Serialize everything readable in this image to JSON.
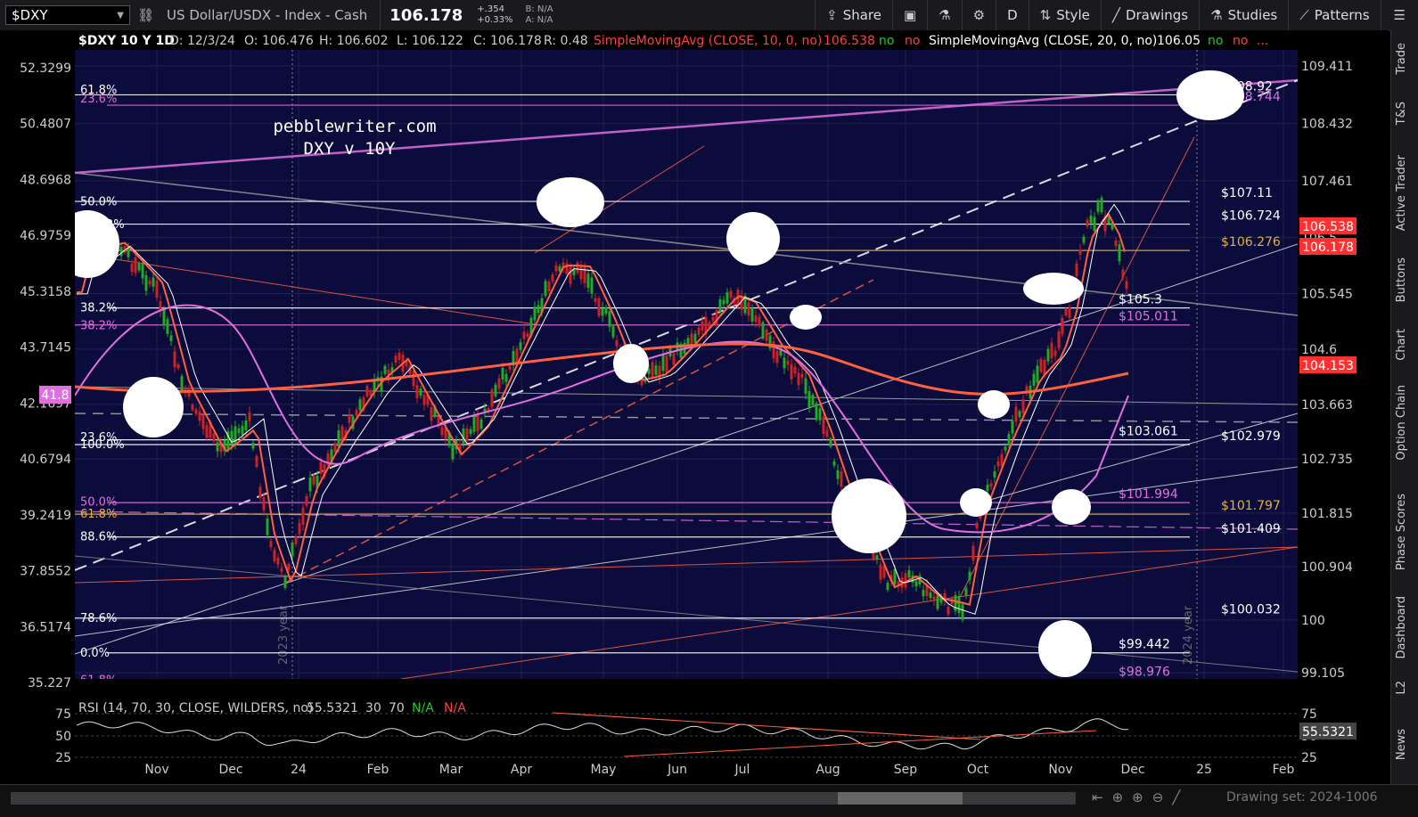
{
  "toolbar": {
    "symbol": "$DXY",
    "description": "US Dollar/USDX - Index - Cash",
    "last": "106.178",
    "change": "+.354",
    "change_pct": "+0.33%",
    "bid": "B: N/A",
    "ask": "A: N/A",
    "share": "Share",
    "period": "D",
    "style": "Style",
    "drawings": "Drawings",
    "studies": "Studies",
    "patterns": "Patterns"
  },
  "header": {
    "title": "$DXY 10 Y 1D",
    "date": "D: 12/3/24",
    "open": "O: 106.476",
    "high": "H: 106.602",
    "low": "L: 106.122",
    "close": "C: 106.178",
    "range": "R: 0.48",
    "sma10_label": "SimpleMovingAvg (CLOSE, 10, 0, no)",
    "sma10_value": "106.538",
    "sma20_label": "SimpleMovingAvg (CLOSE, 20, 0, no)",
    "sma20_value": "106.05",
    "no": "no",
    "more": "..."
  },
  "side_tabs": [
    "Trade",
    "T&S",
    "Active Trader",
    "Buttons",
    "Chart",
    "Option Chain",
    "Phase Scores",
    "Dashboard",
    "L2",
    "News"
  ],
  "watermark": {
    "line1": "pebblewriter.com",
    "line2": "DXY v 10Y"
  },
  "colors": {
    "background": "#0b0b3c",
    "candle_up": "#22aa22",
    "candle_down": "#cc2222",
    "sma10": "#ff6040",
    "sma20": "#ffffff",
    "magenta": "#e070e0",
    "gold": "#e0b040"
  },
  "chart_data": {
    "type": "candlestick",
    "x_months": [
      "Nov",
      "Dec",
      "24",
      "Feb",
      "Mar",
      "Apr",
      "May",
      "Jun",
      "Jul",
      "Aug",
      "Sep",
      "Oct",
      "Nov",
      "Dec",
      "25",
      "Feb"
    ],
    "year_markers": [
      "2023 year",
      "2024 year"
    ],
    "right_axis_dxy": {
      "ylim": [
        99.105,
        109.411
      ],
      "ticks": [
        "109.411",
        "108.432",
        "107.461",
        "106.5",
        "105.545",
        "104.6",
        "103.663",
        "102.735",
        "101.815",
        "100.904",
        "100",
        "99.105"
      ]
    },
    "left_axis_10y": {
      "ylim": [
        35.227,
        52.3299
      ],
      "ticks": [
        "52.3299",
        "50.4807",
        "48.6968",
        "46.9759",
        "45.3158",
        "43.7145",
        "42.1697",
        "40.6794",
        "39.2419",
        "37.8552",
        "36.5174",
        "35.227"
      ],
      "current": "41.8"
    },
    "last_price_labels": [
      {
        "value": "106.538",
        "color": "#ff3030"
      },
      {
        "value": "106.178",
        "color": "#ff3030"
      },
      {
        "value": "104.153",
        "color": "#ff3030"
      }
    ],
    "levels": [
      {
        "label": "$108.92",
        "price": 108.92,
        "color": "#ffffff"
      },
      {
        "label": "$108.744",
        "price": 108.744,
        "color": "#e070e0"
      },
      {
        "label": "$107.11",
        "price": 107.11,
        "color": "#ffffff"
      },
      {
        "label": "$106.724",
        "price": 106.724,
        "color": "#ffffff"
      },
      {
        "label": "$106.276",
        "price": 106.276,
        "color": "#e0b040"
      },
      {
        "label": "$105.3",
        "price": 105.3,
        "color": "#ffffff"
      },
      {
        "label": "$105.011",
        "price": 105.011,
        "color": "#e070e0"
      },
      {
        "label": "$103.061",
        "price": 103.061,
        "color": "#ffffff"
      },
      {
        "label": "$102.979",
        "price": 102.979,
        "color": "#ffffff"
      },
      {
        "label": "$101.994",
        "price": 101.994,
        "color": "#e070e0"
      },
      {
        "label": "$101.797",
        "price": 101.797,
        "color": "#e0b040"
      },
      {
        "label": "$101.409",
        "price": 101.409,
        "color": "#ffffff"
      },
      {
        "label": "$100.032",
        "price": 100.032,
        "color": "#ffffff"
      },
      {
        "label": "$99.442",
        "price": 99.442,
        "color": "#ffffff"
      },
      {
        "label": "$98.976",
        "price": 98.976,
        "color": "#e070e0"
      }
    ],
    "fib_labels": [
      {
        "label": "61.8%",
        "price": 109.0,
        "color": "#ffffff"
      },
      {
        "label": "23.6%",
        "price": 108.85,
        "color": "#e070e0"
      },
      {
        "label": "50.0%",
        "price": 107.1,
        "color": "#ffffff"
      },
      {
        "label": "127.2%",
        "price": 106.72,
        "color": "#ffffff"
      },
      {
        "label": "38.2%",
        "price": 105.3,
        "color": "#ffffff"
      },
      {
        "label": "38.2%",
        "price": 105.0,
        "color": "#e070e0"
      },
      {
        "label": "23.6%",
        "price": 103.1,
        "color": "#ffffff"
      },
      {
        "label": "100.0%",
        "price": 102.98,
        "color": "#ffffff"
      },
      {
        "label": "50.0%",
        "price": 102.0,
        "color": "#e070e0"
      },
      {
        "label": "61.8%",
        "price": 101.8,
        "color": "#e0b040"
      },
      {
        "label": "88.6%",
        "price": 101.41,
        "color": "#ffffff"
      },
      {
        "label": "78.6%",
        "price": 100.03,
        "color": "#ffffff"
      },
      {
        "label": "0.0%",
        "price": 99.44,
        "color": "#ffffff"
      },
      {
        "label": "61.8%",
        "price": 98.98,
        "color": "#e070e0"
      }
    ],
    "rsi": {
      "label": "RSI (14, 70, 30, CLOSE, WILDERS, no)",
      "value": "55.5321",
      "ob": "30",
      "os": "70",
      "na1": "N/A",
      "na2": "N/A",
      "ticks": [
        "75",
        "50",
        "25"
      ]
    }
  },
  "bottom": {
    "drawing_set": "Drawing set: 2024-1006"
  }
}
